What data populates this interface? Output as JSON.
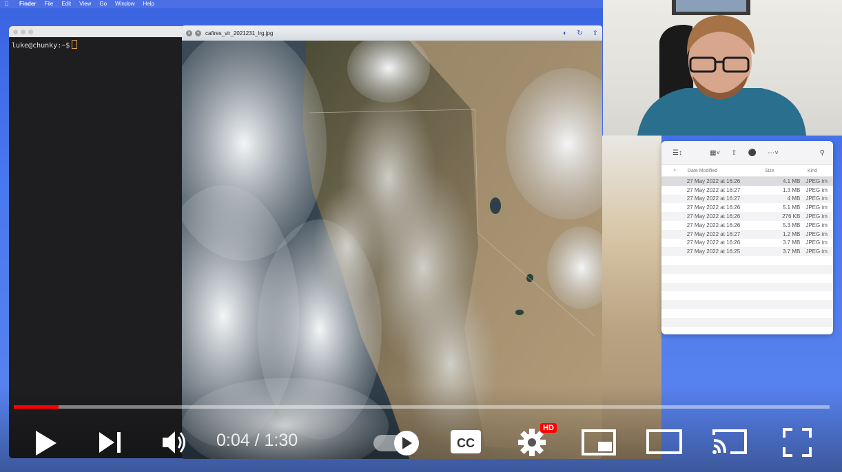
{
  "menubar": {
    "items": [
      "Finder",
      "File",
      "Edit",
      "View",
      "Go",
      "Window",
      "Help"
    ]
  },
  "terminal": {
    "prompt": "luke@chunky:~$"
  },
  "preview": {
    "title": "cafires_vir_2021231_lrg.jpg"
  },
  "finder": {
    "columns": [
      "Date Modified",
      "Size",
      "Kind"
    ],
    "rows": [
      {
        "date": "27 May 2022 at 16:26",
        "size": "4.1 MB",
        "kind": "JPEG im"
      },
      {
        "date": "27 May 2022 at 16:27",
        "size": "1.3 MB",
        "kind": "JPEG im"
      },
      {
        "date": "27 May 2022 at 16:27",
        "size": "4 MB",
        "kind": "JPEG im"
      },
      {
        "date": "27 May 2022 at 16:26",
        "size": "5.1 MB",
        "kind": "JPEG im"
      },
      {
        "date": "27 May 2022 at 16:26",
        "size": "276 KB",
        "kind": "JPEG im"
      },
      {
        "date": "27 May 2022 at 16:26",
        "size": "5.3 MB",
        "kind": "JPEG im"
      },
      {
        "date": "27 May 2022 at 16:27",
        "size": "1.2 MB",
        "kind": "JPEG im"
      },
      {
        "date": "27 May 2022 at 16:26",
        "size": "3.7 MB",
        "kind": "JPEG im"
      },
      {
        "date": "27 May 2022 at 16:25",
        "size": "3.7 MB",
        "kind": "JPEG im"
      }
    ]
  },
  "player": {
    "time": "0:04 / 1:30",
    "progress": 0.055,
    "hd_badge": "HD",
    "accent": "#ff0000"
  }
}
